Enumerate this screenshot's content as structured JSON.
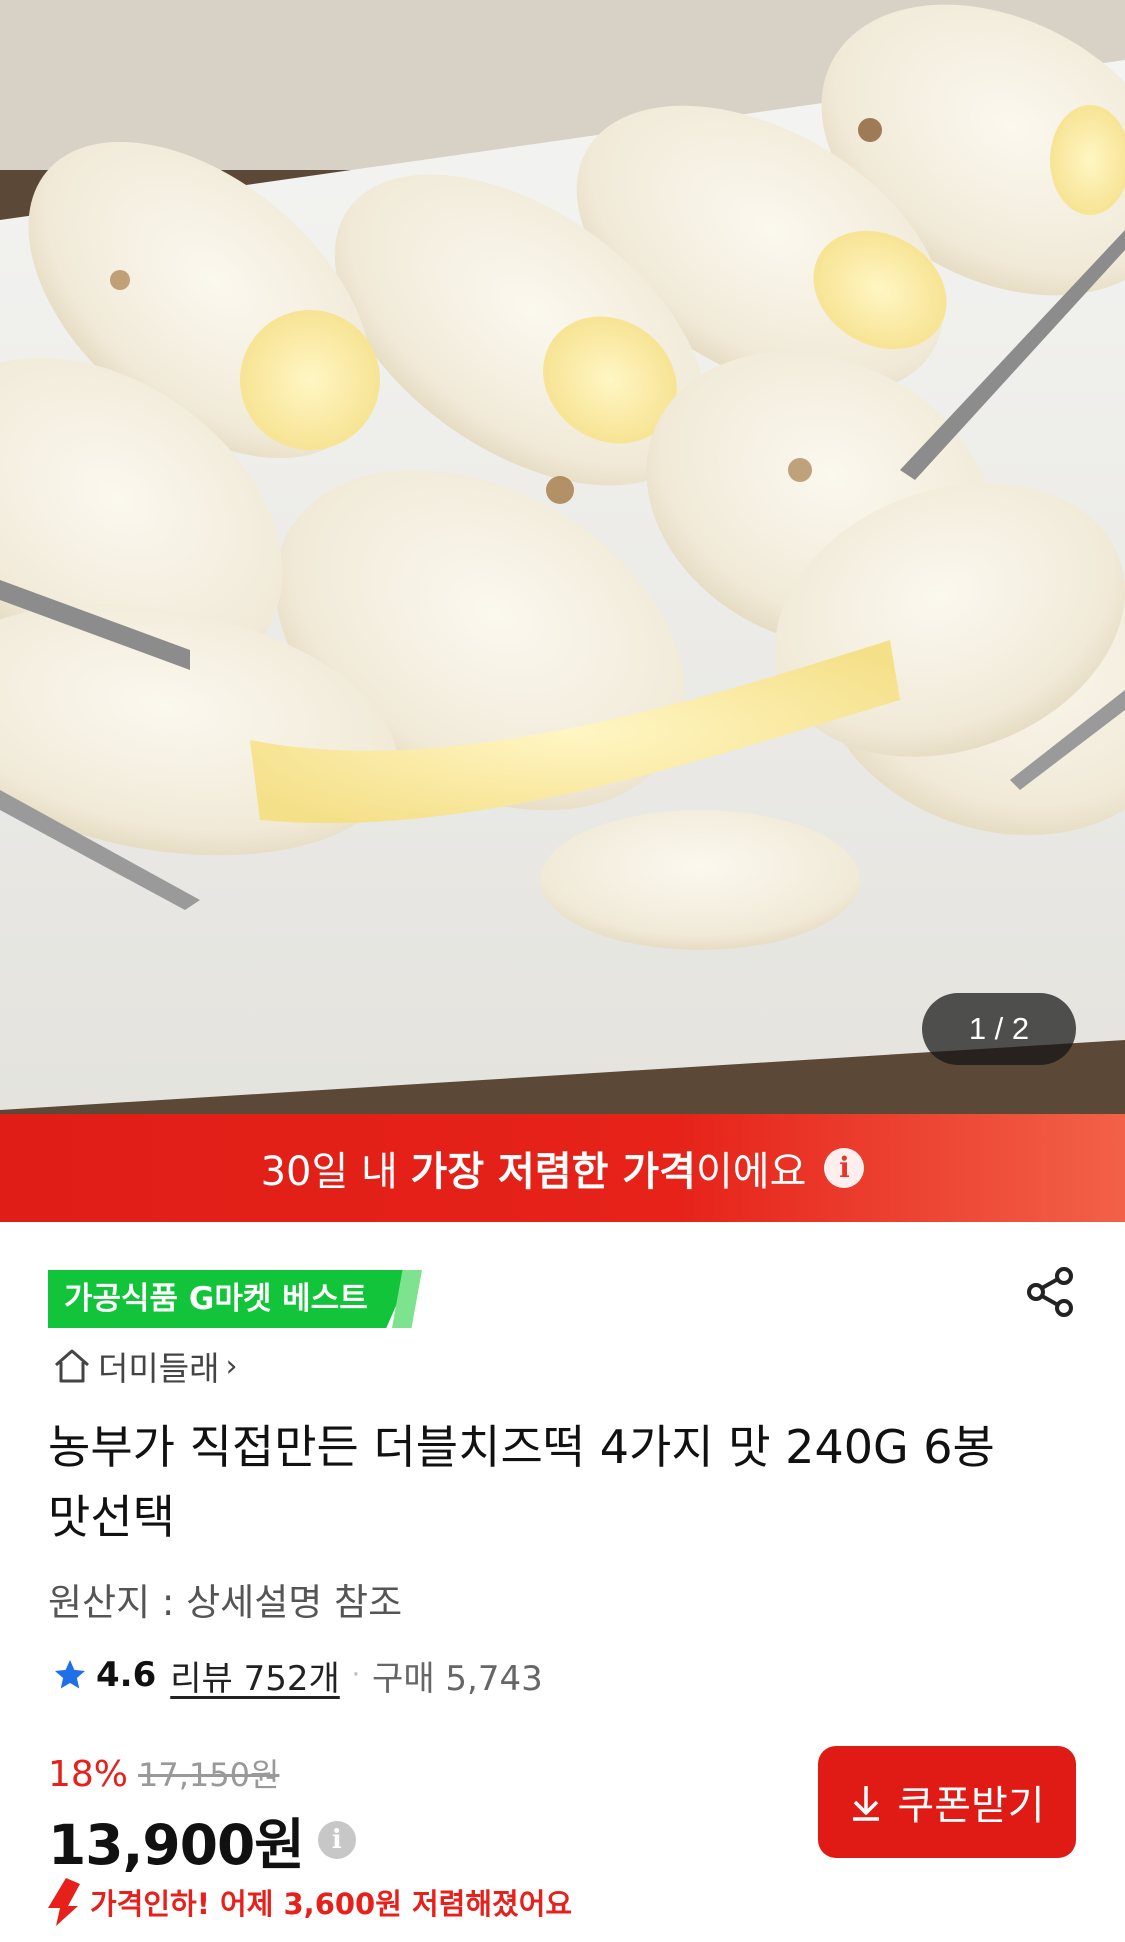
{
  "gallery": {
    "counter": "1 / 2"
  },
  "banner": {
    "prefix": "30일 내 ",
    "highlight": "가장 저렴한 가격",
    "suffix": "이에요",
    "info_icon": "info-icon"
  },
  "badge": {
    "label": "가공식품 G마켓 베스트",
    "color": "#12c43a"
  },
  "store": {
    "name": "더미들래",
    "icon": "home-icon"
  },
  "product": {
    "title": "농부가 직접만든 더블치즈떡 4가지 맛 240G 6봉 맛선택",
    "origin": "원산지 : 상세설명 참조"
  },
  "rating": {
    "score": "4.6",
    "reviews": "리뷰 752개",
    "separator": "·",
    "purchases": "구매 5,743",
    "star_color": "#1f6fe8"
  },
  "pricing": {
    "discount": "18%",
    "original_price": "17,150원",
    "price": "13,900원",
    "drop_notice": "가격인하! 어제 3,600원 저렴해졌어요",
    "accent": "#e8201b"
  },
  "coupon": {
    "label": "쿠폰받기",
    "icon": "download-arrow-icon"
  },
  "share": {
    "icon": "share-icon"
  }
}
